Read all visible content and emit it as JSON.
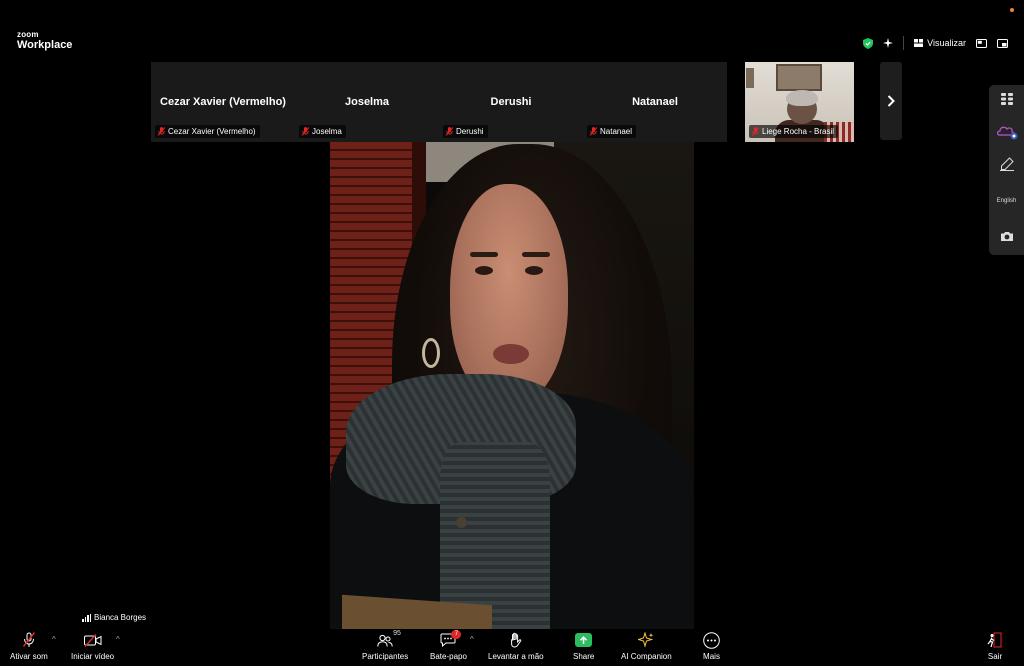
{
  "app": {
    "logo_line1": "zoom",
    "logo_line2": "Workplace"
  },
  "top_right": {
    "view_label": "Visualizar"
  },
  "filmstrip": {
    "tiles": [
      {
        "name": "Cezar Xavier (Vermelho)",
        "label": "Cezar Xavier (Vermelho)"
      },
      {
        "name": "Joselma",
        "label": "Joselma"
      },
      {
        "name": "Derushi",
        "label": "Derushi"
      },
      {
        "name": "Natanael",
        "label": "Natanael"
      }
    ],
    "video_tile": {
      "label": "Liege Rocha - Brasil"
    }
  },
  "sidebar": {
    "language_label": "English"
  },
  "self_view": {
    "name": "Bianca Borges"
  },
  "toolbar": {
    "mic_label": "Ativar som",
    "video_label": "Iniciar vídeo",
    "participants_label": "Participantes",
    "participants_count": "95",
    "chat_label": "Bate-papo",
    "chat_badge": "7",
    "raise_hand_label": "Levantar a mão",
    "share_label": "Share",
    "ai_label": "AI Companion",
    "more_label": "Mais",
    "leave_label": "Sair"
  },
  "colors": {
    "muted_red": "#e02828",
    "share_green": "#2bbd5f",
    "shield_green": "#22c55e",
    "ai_yellow": "#f5c542"
  }
}
